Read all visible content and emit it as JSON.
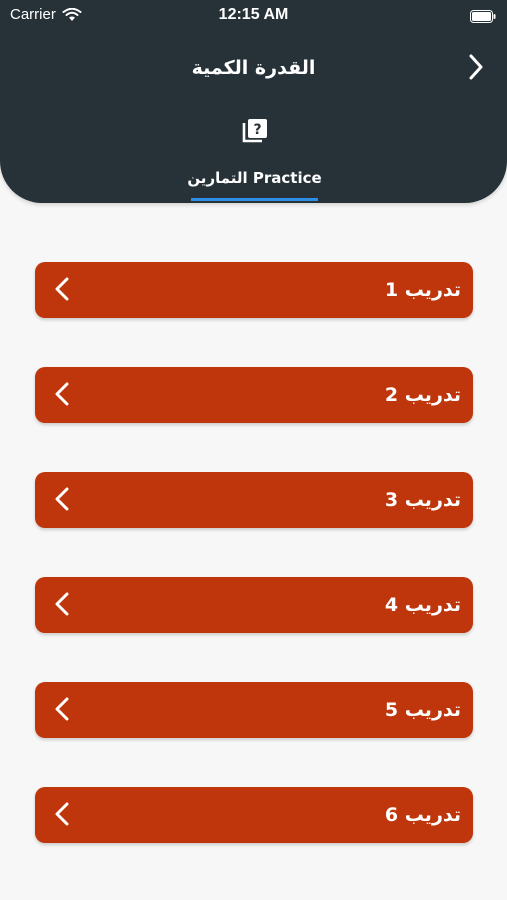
{
  "status_bar": {
    "carrier": "Carrier",
    "time": "12:15 AM"
  },
  "nav": {
    "title": "القدرة الكمية",
    "back_icon": "chevron-right-icon"
  },
  "tabs": [
    {
      "label": "التمارين Practice",
      "icon": "quiz-icon",
      "selected": true
    }
  ],
  "practice_items": [
    {
      "label": "تدريب 1"
    },
    {
      "label": "تدريب 2"
    },
    {
      "label": "تدريب 3"
    },
    {
      "label": "تدريب 4"
    },
    {
      "label": "تدريب 5"
    },
    {
      "label": "تدريب 6"
    }
  ],
  "colors": {
    "header": "#263238",
    "item": "#bf360c",
    "tab_indicator": "#2f8fe6",
    "background": "#f7f7f7"
  }
}
